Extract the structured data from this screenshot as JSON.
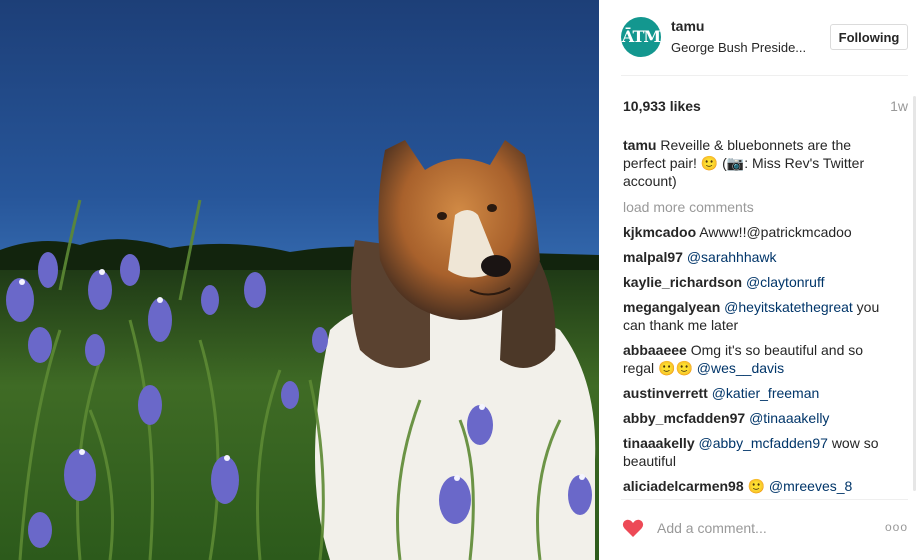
{
  "photo": {
    "alt_icon": "post-photo"
  },
  "header": {
    "avatar_text": "ĀTM",
    "username": "tamu",
    "location": "George Bush Preside...",
    "follow_label": "Following"
  },
  "stats": {
    "likes": "10,933 likes",
    "time": "1w"
  },
  "caption": {
    "user": "tamu",
    "text": "Reveille & bluebonnets are the perfect pair! 🙂 (📷: Miss Rev's Twitter account)"
  },
  "load_more": "load more comments",
  "comments": [
    {
      "user": "kjkmcadoo",
      "text": "Awww!!@patrickmcadoo",
      "mention": ""
    },
    {
      "user": "malpal97",
      "text": "",
      "mention": "@sarahhhawk"
    },
    {
      "user": "kaylie_richardson",
      "text": "",
      "mention": "@claytonruff"
    },
    {
      "user": "megangalyean",
      "text": "",
      "mention": "@heyitskatethegreat",
      "after": "you can thank me later"
    },
    {
      "user": "abbaaeee",
      "text": "Omg it's so beautiful and so regal 🙂🙂",
      "mention": "@wes__davis"
    },
    {
      "user": "austinverrett",
      "text": "",
      "mention": "@katier_freeman"
    },
    {
      "user": "abby_mcfadden97",
      "text": "",
      "mention": "@tinaaakelly"
    },
    {
      "user": "tinaaakelly",
      "text": "",
      "mention": "@abby_mcfadden97",
      "after": "wow so beautiful"
    },
    {
      "user": "aliciadelcarmen98",
      "text": "🙂",
      "mention": "@mreeves_8"
    }
  ],
  "footer": {
    "placeholder": "Add a comment...",
    "more": "ooo",
    "heart_color": "#ed4956"
  }
}
